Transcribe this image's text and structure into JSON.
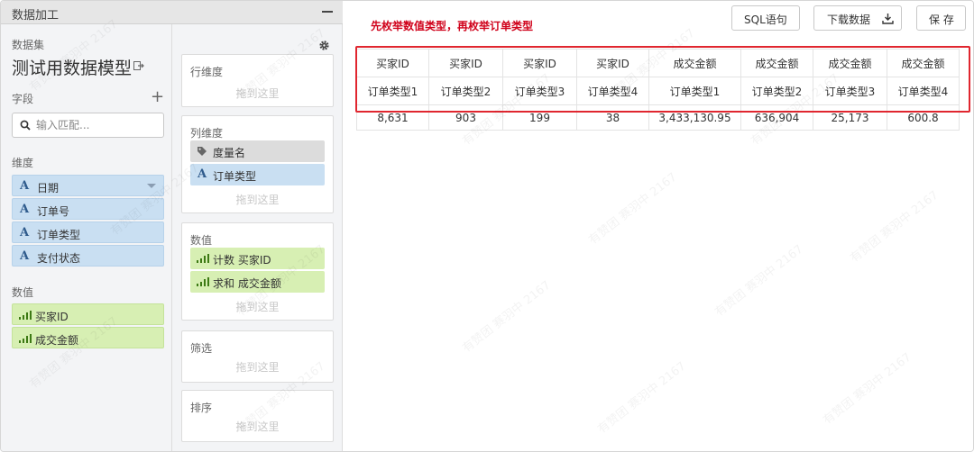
{
  "panel": {
    "title": "数据加工"
  },
  "dataset": {
    "label": "数据集",
    "name": "测试用数据模型"
  },
  "fields": {
    "label": "字段",
    "search_placeholder": "输入匹配...",
    "dimension_label": "维度",
    "measure_label": "数值",
    "dimensions": [
      {
        "type_icon": "A",
        "label": "日期"
      },
      {
        "type_icon": "A",
        "label": "订单号"
      },
      {
        "type_icon": "A",
        "label": "订单类型"
      },
      {
        "type_icon": "A",
        "label": "支付状态"
      }
    ],
    "measures": [
      {
        "label": "买家ID"
      },
      {
        "label": "成交金额"
      }
    ]
  },
  "shelves": {
    "row": {
      "title": "行维度",
      "hint": "拖到这里"
    },
    "column": {
      "title": "列维度",
      "hint": "拖到这里",
      "items": [
        {
          "kind": "tag",
          "label": "度量名"
        },
        {
          "kind": "dim",
          "type_icon": "A",
          "label": "订单类型"
        }
      ]
    },
    "values": {
      "title": "数值",
      "hint": "拖到这里",
      "items": [
        {
          "label": "计数 买家ID"
        },
        {
          "label": "求和 成交金额"
        }
      ]
    },
    "filter": {
      "title": "筛选",
      "hint": "拖到这里"
    },
    "sort": {
      "title": "排序",
      "hint": "拖到这里"
    }
  },
  "toolbar": {
    "sql_label": "SQL语句",
    "download_label": "下载数据",
    "save_label": "保 存"
  },
  "annotation": "先枚举数值类型，再枚举订单类型",
  "table": {
    "header_measures": [
      "买家ID",
      "买家ID",
      "买家ID",
      "买家ID",
      "成交金额",
      "成交金额",
      "成交金额",
      "成交金额"
    ],
    "header_types": [
      "订单类型1",
      "订单类型2",
      "订单类型3",
      "订单类型4",
      "订单类型1",
      "订单类型2",
      "订单类型3",
      "订单类型4"
    ],
    "values": [
      "8,631",
      "903",
      "199",
      "38",
      "3,433,130.95",
      "636,904",
      "25,173",
      "600.8"
    ]
  },
  "watermark": "有赞团 赛羽中 2167",
  "colors": {
    "dimension_chip": "#c9dff2",
    "measure_chip": "#d7efb3",
    "tag_chip": "#dcdcdc",
    "annotation": "#d0021b",
    "highlight_border": "#e0262f"
  }
}
